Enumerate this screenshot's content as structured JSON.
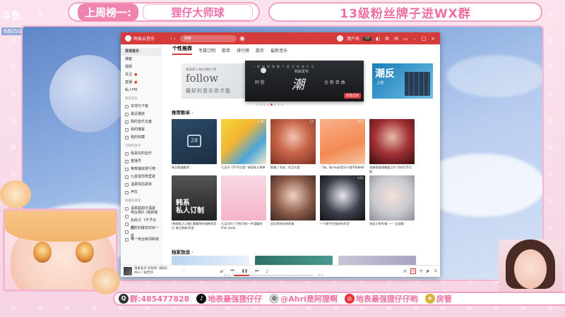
{
  "overlay": {
    "rank_label": "上周榜一:",
    "rank_value": "狸仔大师球",
    "fan_group": "13级粉丝牌子进WX群",
    "room_no": "68050",
    "bottom_qq_label": "群:485477828",
    "bottom_douyin": "地表最强狸仔仔",
    "bottom_weibo": "@Ahri是阿狸啊",
    "bottom_other": "地表最强狸仔仔哟",
    "bottom_manager": "房管"
  },
  "app": {
    "name": "网易云音乐",
    "search_placeholder": "搜索",
    "user_name": "用户名",
    "vip": "VIP",
    "tabs": [
      "个性推荐",
      "专属订制",
      "歌单",
      "排行榜",
      "歌手",
      "最新音乐"
    ],
    "sidebar": {
      "top_items": [
        "发现音乐",
        "播客",
        "视频",
        "关注",
        "直播",
        "私人FM"
      ],
      "my_music_head": "我的音乐",
      "my_music_items": [
        "本地与下载",
        "最近播放",
        "我的音乐云盘",
        "我的播客",
        "我的收藏"
      ],
      "created_head": "创建的歌单",
      "created_items": [
        "我喜欢的音乐",
        "重播号",
        "推荐播放排行榜",
        "九首很恐怖里歌",
        "温柔情侣歌单",
        "声优"
      ],
      "collected_head": "收藏的歌单",
      "collected_items": [
        "温柔超甜日语歌",
        "电台相片 (我猜离人)",
        "七月/3 《不予言语》",
        "苏打的睡觉欢快一首",
        "唯一电台新闻新歌"
      ]
    },
    "banner": {
      "left_small": "周末听 | Wa:R姆少爷",
      "left_big": "follow",
      "left_sub": "最好的音乐你才能",
      "main_strip": "一 时 时 时 和 那 个 夏 天 的 流 行 乐",
      "main_brand": "新曲发布",
      "main_big": "潮",
      "main_left": "阿 胜",
      "main_right": "全 新 单 曲",
      "main_tag": "新歌首发",
      "right_title": "潮反",
      "right_sub": "上线"
    },
    "section_recommend": "推荐歌单",
    "section_exclusive": "独家放送",
    "chevron": "›",
    "playlists": [
      {
        "title": "每日歌曲推荐",
        "plays": "",
        "art": "calendar",
        "cal": "28"
      },
      {
        "title": "七月/3《不予言语》听起私人歌单",
        "plays": "2.4亿",
        "art": "yellow"
      },
      {
        "title": "欧美 | 早安，在日光里",
        "plays": "1万",
        "art": "girl-red"
      },
      {
        "title": "「纯」Springe音乐十首不妨听听",
        "plays": "11万",
        "art": "orange"
      },
      {
        "title": "张雅萌爱唱歌曲三代 可听可不可能",
        "plays": "",
        "art": "dark-red"
      },
      {
        "title": "[韩国私人订制] 最懂你的纯韩系音乐 每日更新35首",
        "plays": "",
        "art": "band",
        "overlay": "韩系\n私人订制"
      },
      {
        "title": "七月/3约 / 为你写给一件温暖的 Pink Soda",
        "plays": "",
        "art": "pink-drink"
      },
      {
        "title": "回忆那些年听的歌",
        "plays": "",
        "art": "girl-brown"
      },
      {
        "title": "一个歌手在城市的声音",
        "plays": "14万",
        "art": "anime-dark"
      },
      {
        "title": "张佳小那专辑 —— 全部歌",
        "plays": "",
        "art": "girl-white"
      }
    ],
    "player": {
      "song": "温柔女声 好好听 (歌词)",
      "artist": "Ahri / 张佳仔",
      "time_current": "00:41",
      "time_total": "03:47",
      "progress": 0.2,
      "badge": "词"
    }
  },
  "colors": {
    "netease_red": "#d63b3b",
    "overlay_pink": "#ef6fa3"
  }
}
